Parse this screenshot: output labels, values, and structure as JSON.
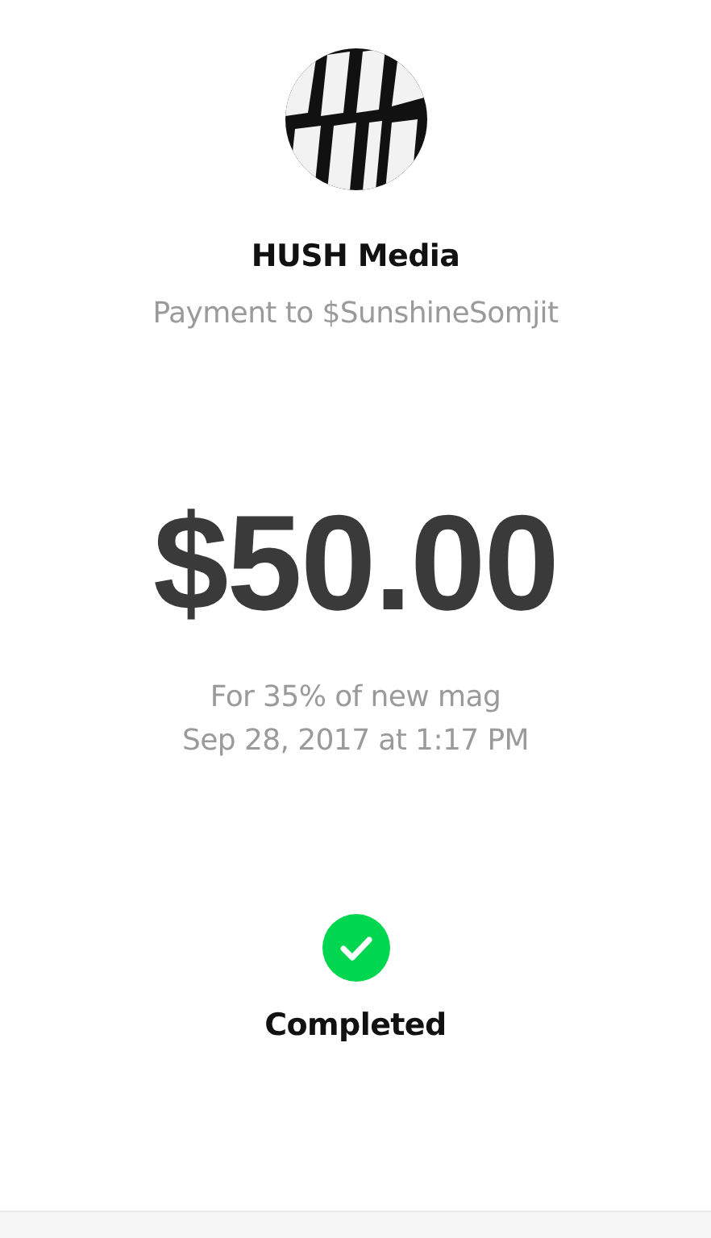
{
  "merchant": {
    "name": "HUSH Media",
    "subtitle": "Payment to $SunshineSomjit"
  },
  "amount": "$50.00",
  "note": "For 35% of new mag",
  "date": "Sep 28, 2017 at 1:17 PM",
  "status": {
    "kind": "completed",
    "label": "Completed"
  }
}
